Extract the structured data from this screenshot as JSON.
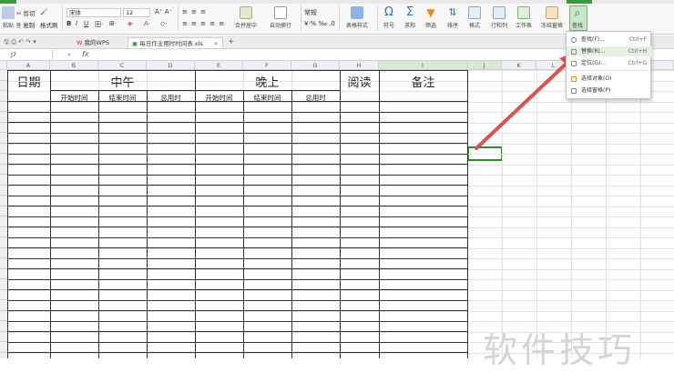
{
  "ribbon": {
    "cut_label": "剪切",
    "copy_label": "复制",
    "format_painter_label": "格式刷",
    "paste_label": "粘贴",
    "font_name": "宋体",
    "font_size": "12",
    "merge_center_label": "合并居中",
    "wrap_text_label": "自动换行",
    "number_format": "常规",
    "table_style_label": "表格样式",
    "symbol_label": "符号",
    "sum_label": "求和",
    "filter_label": "筛选",
    "sort_label": "排序",
    "format_label": "格式",
    "rowcol_label": "行和列",
    "worksheet_label": "工作表",
    "freeze_label": "冻结窗格",
    "find_label": "查找"
  },
  "tabs": [
    {
      "label": "我的WPS"
    },
    {
      "label": "每日作业用时时间表.xls"
    }
  ],
  "formula_bar": {
    "name_box": "J7",
    "fx": "fx",
    "value": ""
  },
  "columns": [
    "A",
    "B",
    "C",
    "D",
    "E",
    "F",
    "G",
    "H",
    "I",
    "J",
    "K",
    "L",
    "M"
  ],
  "sheet": {
    "date_header": "日期",
    "noon_header": "中午",
    "evening_header": "晚上",
    "reading_header": "阅读",
    "notes_header": "备注",
    "start_time": "开始时间",
    "end_time": "结束时间",
    "total_time": "总用时"
  },
  "find_menu": {
    "items": [
      {
        "label": "查找(F)...",
        "shortcut": "Ctrl+F"
      },
      {
        "label": "替换(R)...",
        "shortcut": "Ctrl+H"
      },
      {
        "label": "定位(G)...",
        "shortcut": "Ctrl+G"
      },
      {
        "label": "选择对象(O)",
        "shortcut": ""
      },
      {
        "label": "选择窗格(P)",
        "shortcut": ""
      }
    ]
  },
  "watermark": "软件技巧",
  "colors": {
    "accent": "#2e8b2e",
    "arrow": "#d9534f",
    "menu_bg": "#ffffff"
  }
}
